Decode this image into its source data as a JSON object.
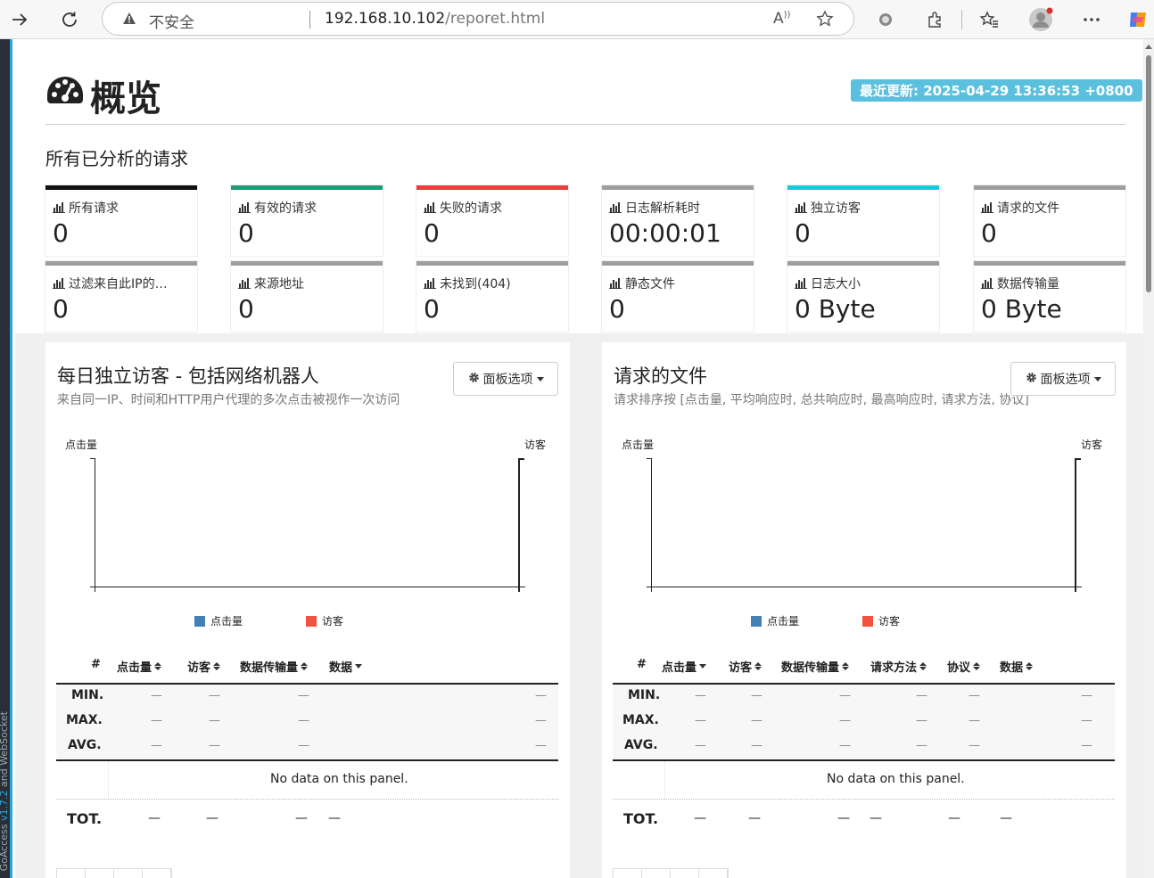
{
  "browser": {
    "insecure_label": "不安全",
    "host": "192.168.10.102",
    "path": "/reporet.html"
  },
  "sidebar_text": {
    "prefix": "GoAccess ",
    "version": "v1.7.2",
    "suffix": " and WebSocket"
  },
  "header": {
    "title": "概览",
    "last_updated": "最近更新: 2025-04-29 13:36:53 +0800"
  },
  "overall": {
    "section_title": "所有已分析的请求",
    "cards": [
      {
        "label": "所有请求",
        "value": "0",
        "color": "#111111"
      },
      {
        "label": "有效的请求",
        "value": "0",
        "color": "#1e9e76"
      },
      {
        "label": "失败的请求",
        "value": "0",
        "color": "#e8403c"
      },
      {
        "label": "日志解析耗时",
        "value": "00:00:01",
        "color": "#9e9e9e"
      },
      {
        "label": "独立访客",
        "value": "0",
        "color": "#1ec8d9"
      },
      {
        "label": "请求的文件",
        "value": "0",
        "color": "#9e9e9e"
      },
      {
        "label": "过滤来自此IP的…",
        "value": "0",
        "color": "#9e9e9e"
      },
      {
        "label": "来源地址",
        "value": "0",
        "color": "#9e9e9e"
      },
      {
        "label": "未找到(404)",
        "value": "0",
        "color": "#9e9e9e"
      },
      {
        "label": "静态文件",
        "value": "0",
        "color": "#9e9e9e"
      },
      {
        "label": "日志大小",
        "value": "0 Byte",
        "color": "#9e9e9e"
      },
      {
        "label": "数据传输量",
        "value": "0 Byte",
        "color": "#9e9e9e"
      }
    ]
  },
  "panels": [
    {
      "title": "每日独立访客 - 包括网络机器人",
      "subtitle": "来自同一IP、时间和HTTP用户代理的多次点击被视作一次访问",
      "options_label": "面板选项",
      "y_left": "点击量",
      "y_right": "访客",
      "legend": [
        {
          "label": "点击量",
          "color": "#447fb5"
        },
        {
          "label": "访客",
          "color": "#f0533f"
        }
      ],
      "columns": [
        "#",
        "点击量",
        "访客",
        "数据传输量",
        "数据"
      ],
      "rows": [
        "MIN.",
        "MAX.",
        "AVG."
      ],
      "no_data": "No data on this panel.",
      "total_label": "TOT.",
      "dash": "—"
    },
    {
      "title": "请求的文件",
      "subtitle": "请求排序按 [点击量, 平均响应时, 总共响应时, 最高响应时, 请求方法, 协议]",
      "options_label": "面板选项",
      "y_left": "点击量",
      "y_right": "访客",
      "legend": [
        {
          "label": "点击量",
          "color": "#447fb5"
        },
        {
          "label": "访客",
          "color": "#f0533f"
        }
      ],
      "columns": [
        "#",
        "点击量",
        "访客",
        "数据传输量",
        "请求方法",
        "协议",
        "数据"
      ],
      "rows": [
        "MIN.",
        "MAX.",
        "AVG."
      ],
      "no_data": "No data on this panel.",
      "total_label": "TOT.",
      "dash": "—"
    }
  ]
}
